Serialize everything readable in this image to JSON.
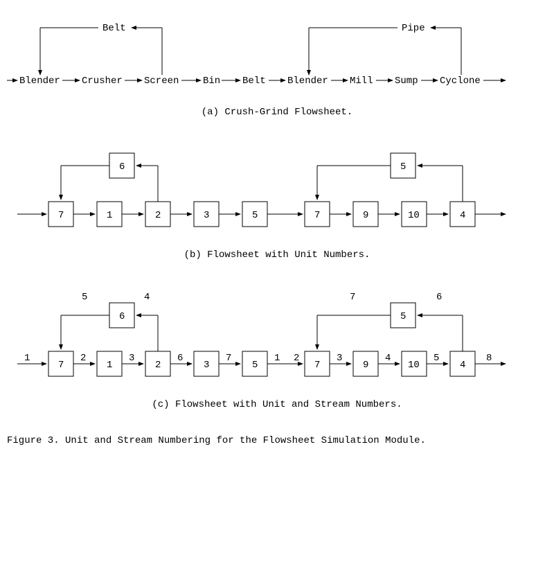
{
  "panelA": {
    "nodes": [
      "Blender",
      "Crusher",
      "Screen",
      "Bin",
      "Belt",
      "Blender",
      "Mill",
      "Sump",
      "Cyclone"
    ],
    "recycles": [
      {
        "label": "Belt"
      },
      {
        "label": "Pipe"
      }
    ],
    "caption": "(a)   Crush-Grind Flowsheet."
  },
  "panelB": {
    "unitNumbers": [
      "7",
      "1",
      "2",
      "3",
      "5",
      "7",
      "9",
      "10",
      "4"
    ],
    "recycle1": "6",
    "recycle2": "5",
    "caption": "(b)   Flowsheet with Unit Numbers."
  },
  "panelC": {
    "unitNumbers": [
      "7",
      "1",
      "2",
      "3",
      "5",
      "7",
      "9",
      "10",
      "4"
    ],
    "recycle1": "6",
    "recycle2": "5",
    "streamBottom": [
      "1",
      "2",
      "3",
      "6",
      "7",
      "1",
      "2",
      "3",
      "4",
      "5",
      "8"
    ],
    "streamTop1": [
      "5",
      "4"
    ],
    "streamTop2": [
      "7",
      "6"
    ],
    "caption": "(c)   Flowsheet with Unit and Stream Numbers."
  },
  "figure": "Figure 3.  Unit and Stream Numbering for the Flowsheet Simulation Module."
}
